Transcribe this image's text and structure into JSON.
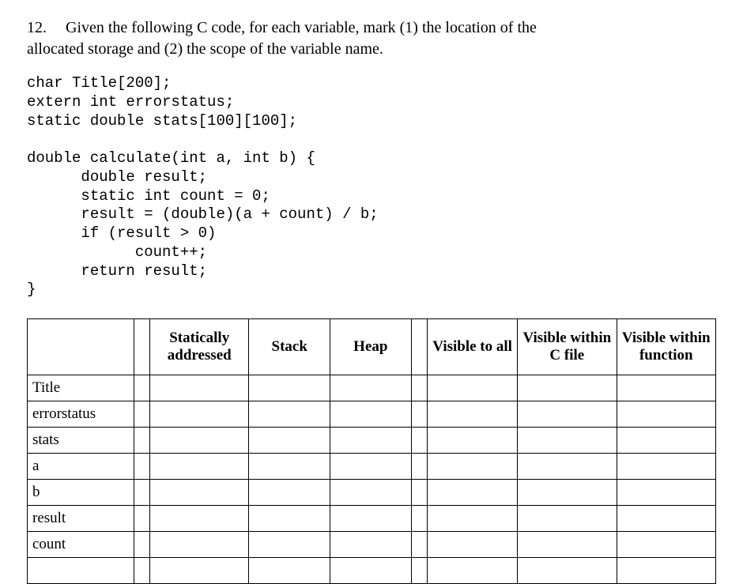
{
  "question": {
    "number": "12.",
    "text_a": "Given the following C code, for each variable, mark (1) the location of the",
    "text_b": "allocated storage and (2) the scope of the variable name."
  },
  "code": "char Title[200];\nextern int errorstatus;\nstatic double stats[100][100];\n\ndouble calculate(int a, int b) {\n      double result;\n      static int count = 0;\n      result = (double)(a + count) / b;\n      if (result > 0)\n            count++;\n      return result;\n}",
  "table": {
    "headers": {
      "blank1": "",
      "blank2": "",
      "static": "Statically addressed",
      "stack": "Stack",
      "heap": "Heap",
      "blank3": "",
      "vis_all": "Visible to all",
      "vis_file": "Visible within C file",
      "vis_fn": "Visible within function"
    },
    "rows": [
      {
        "name": "Title"
      },
      {
        "name": "errorstatus"
      },
      {
        "name": "stats"
      },
      {
        "name": "a"
      },
      {
        "name": "b"
      },
      {
        "name": "result"
      },
      {
        "name": "count"
      },
      {
        "name": ""
      }
    ]
  }
}
